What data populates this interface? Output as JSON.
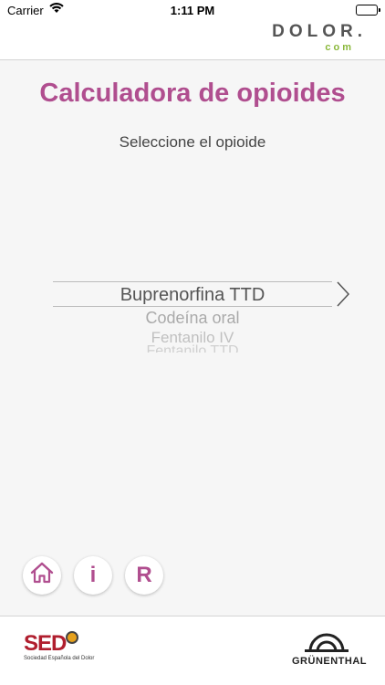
{
  "status_bar": {
    "carrier": "Carrier",
    "time": "1:11 PM"
  },
  "header": {
    "logo_main": "DOLOR.",
    "logo_com": "com"
  },
  "main": {
    "title": "Calculadora de opioides",
    "subtitle": "Seleccione el opioide",
    "picker": {
      "selected": "Buprenorfina TTD",
      "options": [
        "Buprenorfina TTD",
        "Codeína oral",
        "Fentanilo IV",
        "Fentanilo TTD"
      ]
    }
  },
  "bottom_buttons": {
    "info_label": "i",
    "r_label": "R"
  },
  "footer": {
    "sed_logo_text": "SED",
    "sed_logo_sub": "Sociedad Española del Dolor",
    "grunenthal_text": "GRÜNENTHAL"
  },
  "colors": {
    "accent": "#b04e8f",
    "logo_green": "#8ab83a",
    "sed_red": "#b01e2e"
  }
}
